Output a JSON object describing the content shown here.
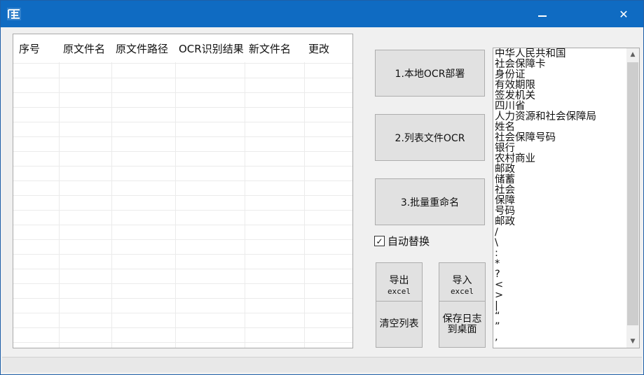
{
  "window": {
    "controls": {
      "minimize_icon": "minimize-icon",
      "close_glyph": "✕"
    }
  },
  "table": {
    "columns": [
      "序号",
      "原文件名",
      "原文件路径",
      "OCR识别结果",
      "新文件名",
      "更改"
    ],
    "rows": []
  },
  "actions": {
    "deploy_label": "1.本地OCR部署",
    "ocr_label": "2.列表文件OCR",
    "rename_label": "3.批量重命名",
    "auto_replace_label": "自动替换",
    "auto_replace_checked": true,
    "export_line1": "导出",
    "export_line2": "excel",
    "import_line1": "导入",
    "import_line2": "excel",
    "clear_label": "清空列表",
    "save_log_line1": "保存日志",
    "save_log_line2": "到桌面"
  },
  "keywords": {
    "lines": [
      "中华人民共和国",
      "社会保障卡",
      "身份证",
      "有效期限",
      "签发机关",
      "四川省",
      "人力资源和社会保障局",
      "姓名",
      "社会保障号码",
      "银行",
      "农村商业",
      "邮政",
      "储蓄",
      "社会",
      "保障",
      "号码",
      "邮政",
      "/",
      "\\",
      ":",
      "*",
      "?",
      "<",
      ">",
      "|",
      "“",
      "”",
      ","
    ]
  },
  "colors": {
    "titlebar": "#0f6bc2",
    "button_face": "#e1e1e1"
  }
}
